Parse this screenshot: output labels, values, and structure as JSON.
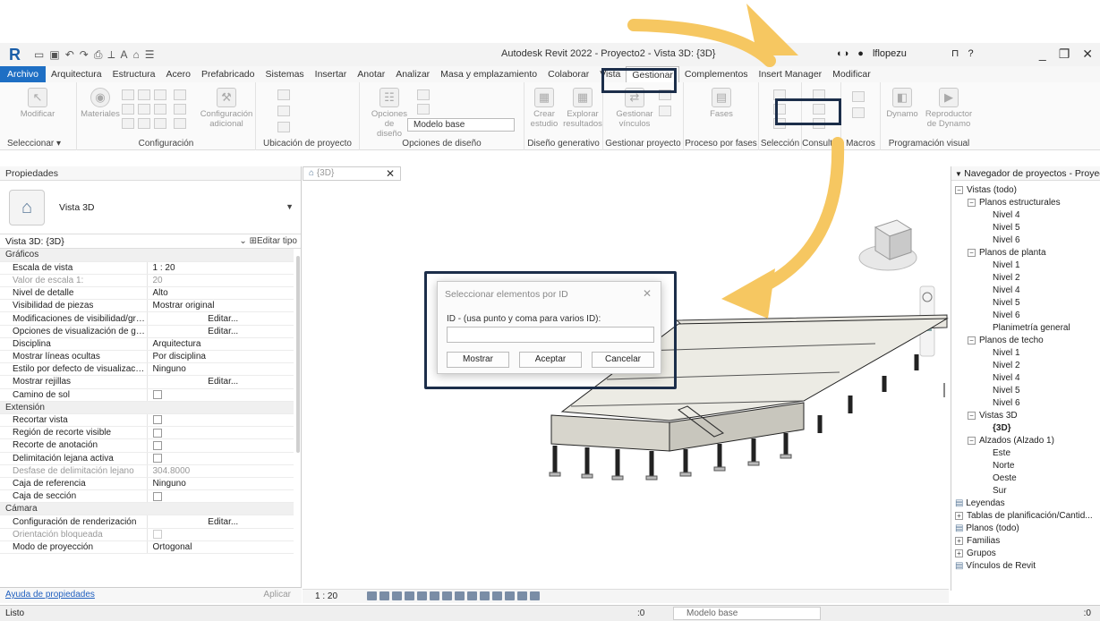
{
  "titlebar": {
    "app_title": "Autodesk Revit 2022 - Proyecto2 - Vista 3D: {3D}",
    "user": "lflopezu"
  },
  "menu_tabs": [
    "Archivo",
    "Arquitectura",
    "Estructura",
    "Acero",
    "Prefabricado",
    "Sistemas",
    "Insertar",
    "Anotar",
    "Analizar",
    "Masa y emplazamiento",
    "Colaborar",
    "Vista",
    "Gestionar",
    "Complementos",
    "Insert Manager",
    "Modificar"
  ],
  "active_tab": "Gestionar",
  "ribbon": {
    "modificar": "Modificar",
    "materiales": "Materiales",
    "config_adicional_1": "Configuración",
    "config_adicional_2": "adicional",
    "opciones_diseno_1": "Opciones de",
    "opciones_diseno_2": "diseño",
    "modelo_base": "Modelo base",
    "crear_estudio_1": "Crear",
    "crear_estudio_2": "estudio",
    "explorar_1": "Explorar",
    "explorar_2": "resultados",
    "gestionar_vinculos_1": "Gestionar",
    "gestionar_vinculos_2": "vínculos",
    "fases": "Fases",
    "dynamo": "Dynamo",
    "reproductor_1": "Reproductor",
    "reproductor_2": "de Dynamo",
    "groups": {
      "seleccionar": "Seleccionar ▾",
      "configuracion": "Configuración",
      "ubicacion": "Ubicación de proyecto",
      "opciones_diseno": "Opciones de diseño",
      "diseno_generativo": "Diseño generativo",
      "gestionar_proyecto": "Gestionar proyecto",
      "proceso_fases": "Proceso por fases",
      "seleccion": "Selección",
      "consultar": "Consultar",
      "macros": "Macros",
      "programacion_visual": "Programación visual"
    }
  },
  "properties": {
    "header": "Propiedades",
    "type_name": "Vista 3D",
    "instance": "Vista 3D: {3D}",
    "edit_type": "Editar tipo",
    "rows": [
      {
        "section": "Gráficos"
      },
      {
        "k": "Escala de vista",
        "v": "1 : 20"
      },
      {
        "k": "Valor de escala   1:",
        "v": "20",
        "disabled": true
      },
      {
        "k": "Nivel de detalle",
        "v": "Alto"
      },
      {
        "k": "Visibilidad de piezas",
        "v": "Mostrar original"
      },
      {
        "k": "Modificaciones de visibilidad/gráf...",
        "v": "Editar...",
        "center": true
      },
      {
        "k": "Opciones de visualización de gráf...",
        "v": "Editar...",
        "center": true
      },
      {
        "k": "Disciplina",
        "v": "Arquitectura"
      },
      {
        "k": "Mostrar líneas ocultas",
        "v": "Por disciplina"
      },
      {
        "k": "Estilo por defecto de visualización...",
        "v": "Ninguno"
      },
      {
        "k": "Mostrar rejillas",
        "v": "Editar...",
        "center": true
      },
      {
        "k": "Camino de sol",
        "cb": true
      },
      {
        "section": "Extensión"
      },
      {
        "k": "Recortar vista",
        "cb": true
      },
      {
        "k": "Región de recorte visible",
        "cb": true
      },
      {
        "k": "Recorte de anotación",
        "cb": true
      },
      {
        "k": "Delimitación lejana activa",
        "cb": true
      },
      {
        "k": "Desfase de delimitación lejano",
        "v": "304.8000",
        "disabled": true
      },
      {
        "k": "Caja de referencia",
        "v": "Ninguno"
      },
      {
        "k": "Caja de sección",
        "cb": true
      },
      {
        "section": "Cámara"
      },
      {
        "k": "Configuración de renderización",
        "v": "Editar...",
        "center": true
      },
      {
        "k": "Orientación bloqueada",
        "cb": true,
        "disabled": true
      },
      {
        "k": "Modo de proyección",
        "v": "Ortogonal"
      }
    ],
    "help_link": "Ayuda de propiedades",
    "apply": "Aplicar"
  },
  "view": {
    "tab_label": "{3D}",
    "scale": "1 : 20"
  },
  "dialog": {
    "title": "Seleccionar elementos por ID",
    "label": "ID - (usa punto y coma para varios ID):",
    "input_value": "",
    "btn_show": "Mostrar",
    "btn_ok": "Aceptar",
    "btn_cancel": "Cancelar"
  },
  "navigator": {
    "header": "Navegador de proyectos - Proyect...",
    "nodes": [
      {
        "t": "Vistas (todo)",
        "lvl": 0,
        "tg": "−"
      },
      {
        "t": "Planos estructurales",
        "lvl": 1,
        "tg": "−"
      },
      {
        "t": "Nivel 4",
        "lvl": 2
      },
      {
        "t": "Nivel 5",
        "lvl": 2
      },
      {
        "t": "Nivel 6",
        "lvl": 2
      },
      {
        "t": "Planos de planta",
        "lvl": 1,
        "tg": "−"
      },
      {
        "t": "Nivel 1",
        "lvl": 2
      },
      {
        "t": "Nivel 2",
        "lvl": 2
      },
      {
        "t": "Nivel 4",
        "lvl": 2
      },
      {
        "t": "Nivel 5",
        "lvl": 2
      },
      {
        "t": "Nivel 6",
        "lvl": 2
      },
      {
        "t": "Planimetría general",
        "lvl": 2
      },
      {
        "t": "Planos de techo",
        "lvl": 1,
        "tg": "−"
      },
      {
        "t": "Nivel 1",
        "lvl": 2
      },
      {
        "t": "Nivel 2",
        "lvl": 2
      },
      {
        "t": "Nivel 4",
        "lvl": 2
      },
      {
        "t": "Nivel 5",
        "lvl": 2
      },
      {
        "t": "Nivel 6",
        "lvl": 2
      },
      {
        "t": "Vistas 3D",
        "lvl": 1,
        "tg": "−"
      },
      {
        "t": "{3D}",
        "lvl": 2,
        "bold": true
      },
      {
        "t": "Alzados (Alzado 1)",
        "lvl": 1,
        "tg": "−"
      },
      {
        "t": "Este",
        "lvl": 2
      },
      {
        "t": "Norte",
        "lvl": 2
      },
      {
        "t": "Oeste",
        "lvl": 2
      },
      {
        "t": "Sur",
        "lvl": 2
      },
      {
        "t": "Leyendas",
        "lvl": 0
      },
      {
        "t": "Tablas de planificación/Cantid...",
        "lvl": 0,
        "tg": "+"
      },
      {
        "t": "Planos (todo)",
        "lvl": 0
      },
      {
        "t": "Familias",
        "lvl": 0,
        "tg": "+"
      },
      {
        "t": "Grupos",
        "lvl": 0,
        "tg": "+"
      },
      {
        "t": "Vínculos de Revit",
        "lvl": 0
      }
    ]
  },
  "status": {
    "ready": "Listo",
    "zero": ":0",
    "model": "Modelo base",
    "right_count": ":0"
  },
  "colors": {
    "highlight": "#1c2e4a",
    "arrow": "#f6c761",
    "file_tab": "#1e6fc4"
  }
}
